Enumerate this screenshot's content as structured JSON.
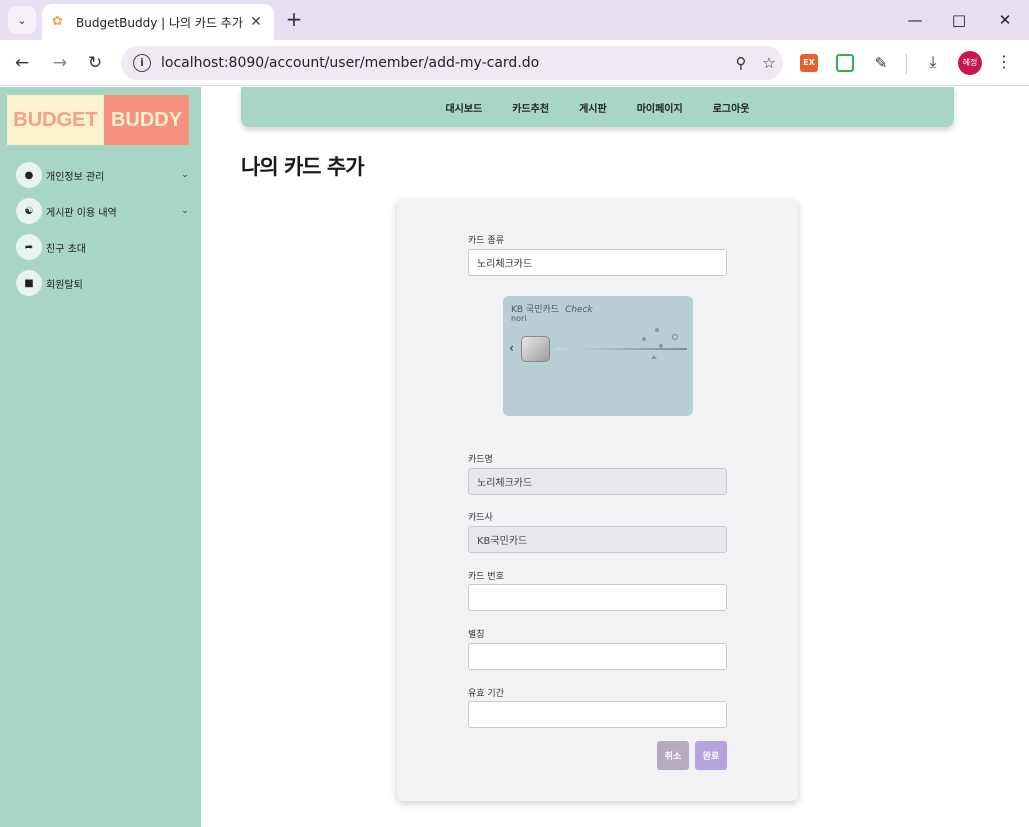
{
  "browser": {
    "tab_title": "BudgetBuddy | 나의 카드 추가",
    "url": "localhost:8090/account/user/member/add-my-card.do",
    "profile_initials": "혜정",
    "extension_label": "EX",
    "icons": {
      "tab_search": "chevron-down",
      "favicon": "flower",
      "close_tab": "close",
      "new_tab": "plus",
      "back": "arrow-left",
      "forward": "arrow-right",
      "reload": "reload",
      "site_info": "info",
      "zoom": "magnifier",
      "bookmark": "star",
      "extensions": "puzzle",
      "downloads": "download",
      "menu": "kebab"
    }
  },
  "logo": {
    "left": "BUDGET",
    "right": "BUDDY"
  },
  "sidebar": {
    "items": [
      {
        "label": "개인정보 관리",
        "icon": "person-icon",
        "has_caret": true
      },
      {
        "label": "게시판 이용 내역",
        "icon": "chat-icon",
        "has_caret": true
      },
      {
        "label": "친구 초대",
        "icon": "share-icon",
        "has_caret": false
      },
      {
        "label": "회원탈퇴",
        "icon": "trash-icon",
        "has_caret": false
      }
    ]
  },
  "topnav": {
    "items": [
      "대시보드",
      "카드추천",
      "게시판",
      "마이페이지",
      "로그아웃"
    ]
  },
  "page_title": "나의 카드 추가",
  "form": {
    "card_type": {
      "label": "카드 종류",
      "value": "노리체크카드"
    },
    "card_image": {
      "brand": "KB 국민카드",
      "check": "Check",
      "sub": "nori"
    },
    "card_name": {
      "label": "카드명",
      "value": "노리체크카드"
    },
    "card_company": {
      "label": "카드사",
      "value": "KB국민카드"
    },
    "card_number": {
      "label": "카드 번호",
      "value": ""
    },
    "nickname": {
      "label": "별칭",
      "value": ""
    },
    "expiry": {
      "label": "유효 기간",
      "value": ""
    },
    "cancel_label": "취소",
    "done_label": "완료"
  },
  "colors": {
    "sidebar_bg": "#a8d5c6",
    "logo_left_bg": "#fbf1cd",
    "logo_right_bg": "#f5917e",
    "cancel_button": "#b5aac0",
    "done_button": "#b4a3dc",
    "profile": "#c6174e"
  }
}
